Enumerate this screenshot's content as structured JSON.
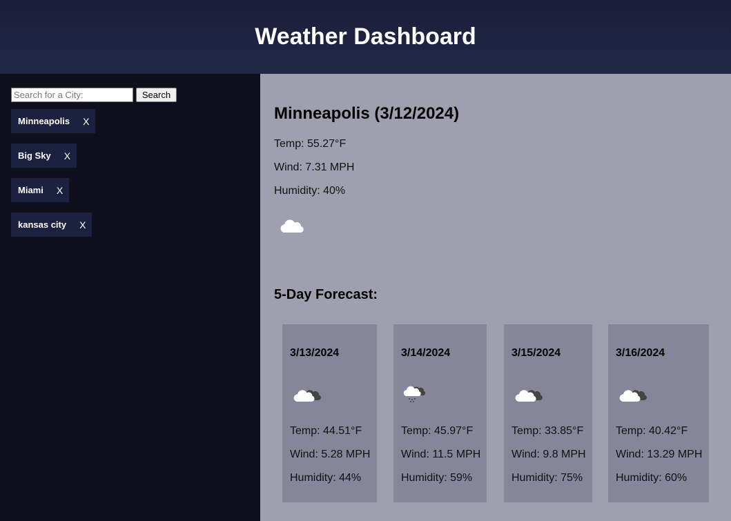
{
  "header": {
    "title": "Weather Dashboard"
  },
  "search": {
    "placeholder": "Search for a City:",
    "value": "",
    "button_label": "Search"
  },
  "history": [
    {
      "city": "Minneapolis",
      "remove": "X"
    },
    {
      "city": "Big Sky",
      "remove": "X"
    },
    {
      "city": "Miami",
      "remove": "X"
    },
    {
      "city": "kansas city",
      "remove": "X"
    }
  ],
  "current": {
    "title": "Minneapolis (3/12/2024)",
    "temp": "Temp: 55.27°F",
    "wind": "Wind: 7.31 MPH",
    "humidity": "Humidity: 40%",
    "icon": "cloud-icon"
  },
  "forecast": {
    "heading": "5-Day Forecast:",
    "days": [
      {
        "date": "3/13/2024",
        "icon": "broken-clouds-icon",
        "temp": "Temp: 44.51°F",
        "wind": "Wind: 5.28 MPH",
        "humidity": "Humidity: 44%"
      },
      {
        "date": "3/14/2024",
        "icon": "snow-icon",
        "temp": "Temp: 45.97°F",
        "wind": "Wind: 11.5 MPH",
        "humidity": "Humidity: 59%"
      },
      {
        "date": "3/15/2024",
        "icon": "broken-clouds-icon",
        "temp": "Temp: 33.85°F",
        "wind": "Wind: 9.8 MPH",
        "humidity": "Humidity: 75%"
      },
      {
        "date": "3/16/2024",
        "icon": "broken-clouds-icon",
        "temp": "Temp: 40.42°F",
        "wind": "Wind: 13.29 MPH",
        "humidity": "Humidity: 60%"
      }
    ]
  },
  "colors": {
    "header_bg": "#1e2340",
    "sidebar_bg": "#100f1c",
    "main_bg": "#a09fb0",
    "card_bg": "#878599",
    "city_button_bg": "#1d2140"
  }
}
